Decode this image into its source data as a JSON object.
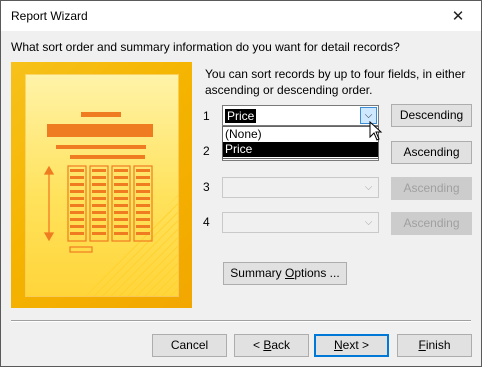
{
  "window": {
    "title": "Report Wizard"
  },
  "prompt": "What sort order and summary information do you want for detail records?",
  "info_text": "You can sort records by up to four fields, in either ascending or descending order.",
  "sort_rows": [
    {
      "number": "1",
      "value": "Price",
      "order_label": "Descending",
      "enabled": true
    },
    {
      "number": "2",
      "value": "",
      "order_label": "Ascending",
      "enabled": true
    },
    {
      "number": "3",
      "value": "",
      "order_label": "Ascending",
      "enabled": false
    },
    {
      "number": "4",
      "value": "",
      "order_label": "Ascending",
      "enabled": false
    }
  ],
  "dropdown": {
    "options": [
      "(None)",
      "Price"
    ],
    "highlighted": "Price"
  },
  "summary_options": {
    "pre": "Summary ",
    "accel": "O",
    "post": "ptions ..."
  },
  "footer_buttons": {
    "cancel": "Cancel",
    "back": {
      "pre": "< ",
      "accel": "B",
      "post": "ack"
    },
    "next": {
      "pre": "",
      "accel": "N",
      "post": "ext >"
    },
    "finish": {
      "pre": "",
      "accel": "F",
      "post": "inish"
    }
  },
  "colors": {
    "accent": "#0078d7",
    "illustration": "#f5b400",
    "illustration_detail": "#f07c22"
  },
  "icons": {
    "close": "close-icon",
    "dropdown_arrow": "chevron-down-icon",
    "cursor": "mouse-pointer-icon"
  }
}
